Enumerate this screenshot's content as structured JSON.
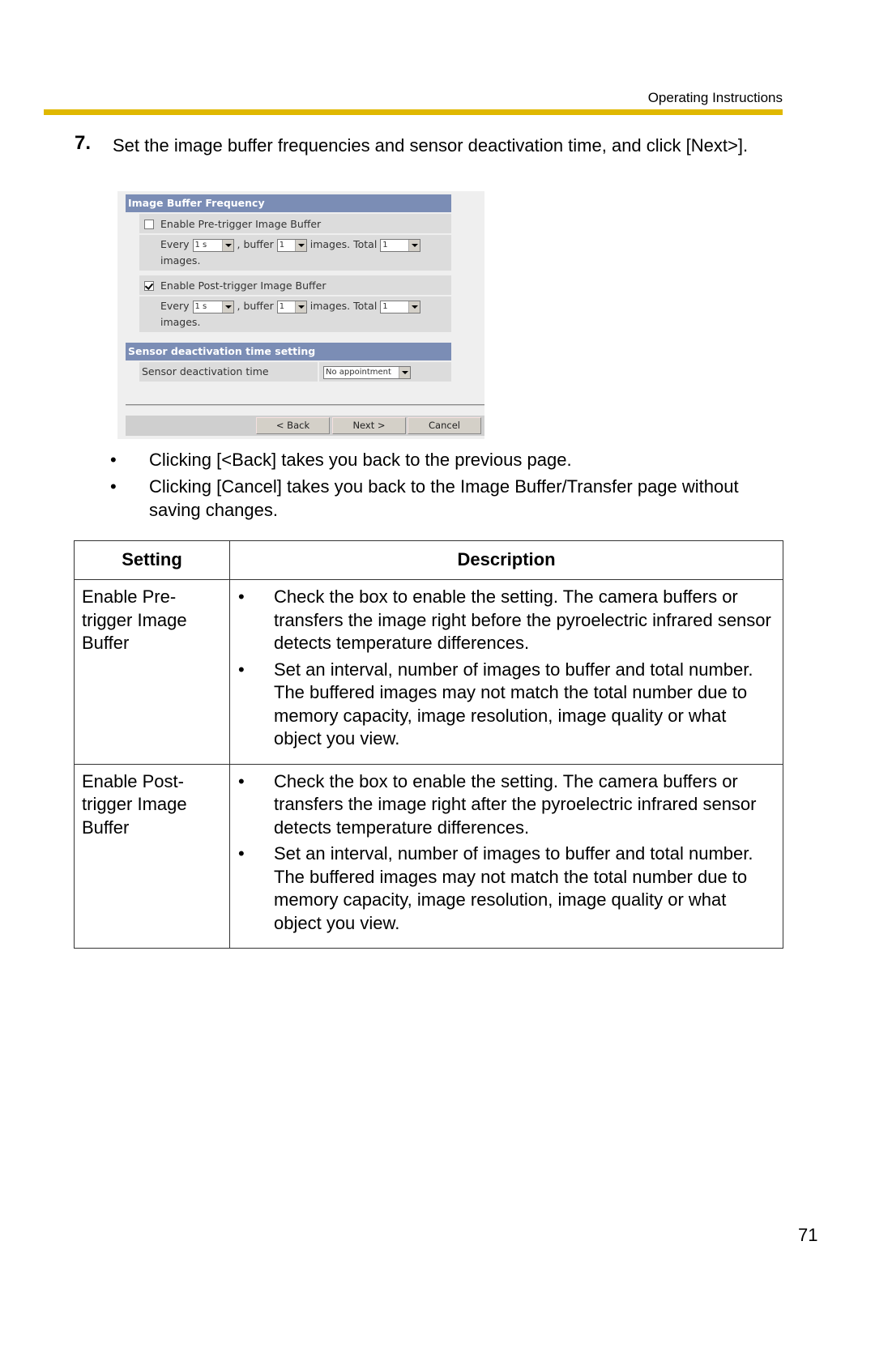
{
  "header": {
    "running_title": "Operating Instructions"
  },
  "step": {
    "number": "7.",
    "text": "Set the image buffer frequencies and sensor deactivation time, and click [Next>]."
  },
  "screenshot": {
    "image_buffer_frequency": {
      "title": "Image Buffer Frequency",
      "pre_trigger": {
        "checkbox_label": "Enable Pre-trigger Image Buffer",
        "checked": false,
        "every_label": "Every",
        "interval": "1 s",
        "buffer_label": ", buffer",
        "buffer": "1",
        "images_total_label": "images. Total",
        "total": "1",
        "images_label": "images."
      },
      "post_trigger": {
        "checkbox_label": "Enable Post-trigger Image Buffer",
        "checked": true,
        "every_label": "Every",
        "interval": "1 s",
        "buffer_label": ", buffer",
        "buffer": "1",
        "images_total_label": "images. Total",
        "total": "1",
        "images_label": "images."
      }
    },
    "sensor": {
      "title": "Sensor deactivation time setting",
      "label": "Sensor deactivation time",
      "value": "No appointment"
    },
    "buttons": {
      "back": "< Back",
      "next": "Next >",
      "cancel": "Cancel"
    }
  },
  "notes": [
    "Clicking [<Back] takes you back to the previous page.",
    "Clicking [Cancel] takes you back to the Image Buffer/Transfer page without saving changes."
  ],
  "bullet_char": "•",
  "table": {
    "headers": [
      "Setting",
      "Description"
    ],
    "rows": [
      {
        "setting": "Enable Pre-trigger Image Buffer",
        "items": [
          "Check the box to enable the setting. The camera buffers or transfers the image right before the pyroelectric infrared sensor detects temperature differences.",
          "Set an interval, number of images to buffer and total number. The buffered images may not match the total number due to memory capacity, image resolution, image quality or what object you view."
        ]
      },
      {
        "setting": "Enable Post-trigger Image Buffer",
        "items": [
          "Check the box to enable the setting. The camera buffers or transfers the image right after the pyroelectric infrared sensor detects temperature differences.",
          "Set an interval, number of images to buffer and total number. The buffered images may not match the total number due to memory capacity, image resolution, image quality or what object you view."
        ]
      }
    ]
  },
  "page_number": "71"
}
